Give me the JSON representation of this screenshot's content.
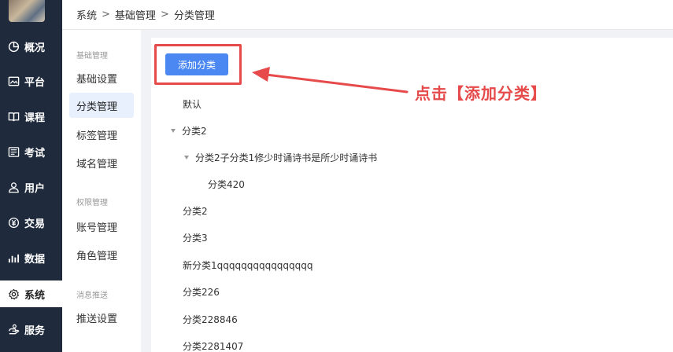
{
  "breadcrumb": {
    "items": [
      "系统",
      "基础管理",
      "分类管理"
    ],
    "separator": ">"
  },
  "sidebar": {
    "items": [
      {
        "label": "概况",
        "icon": "pie-chart-icon",
        "active": false
      },
      {
        "label": "平台",
        "icon": "image-icon",
        "active": false
      },
      {
        "label": "课程",
        "icon": "book-icon",
        "active": false
      },
      {
        "label": "考试",
        "icon": "exam-icon",
        "active": false
      },
      {
        "label": "用户",
        "icon": "user-icon",
        "active": false
      },
      {
        "label": "交易",
        "icon": "yen-icon",
        "active": false
      },
      {
        "label": "数据",
        "icon": "bar-chart-icon",
        "active": false
      },
      {
        "label": "系统",
        "icon": "gear-icon",
        "active": true
      },
      {
        "label": "服务",
        "icon": "service-icon",
        "active": false
      }
    ]
  },
  "submenu": {
    "groups": [
      {
        "title": "基础管理",
        "items": [
          "基础设置",
          "分类管理",
          "标签管理",
          "域名管理"
        ]
      },
      {
        "title": "权限管理",
        "items": [
          "账号管理",
          "角色管理"
        ]
      },
      {
        "title": "消息推送",
        "items": [
          "推送设置"
        ]
      }
    ],
    "active": "分类管理"
  },
  "main": {
    "add_button": "添加分类",
    "tree": [
      {
        "label": "默认",
        "level": 0,
        "expandable": false
      },
      {
        "label": "分类2",
        "level": 0,
        "expandable": true
      },
      {
        "label": "分类2子分类1修少时诵诗书是所少时诵诗书",
        "level": 1,
        "expandable": true
      },
      {
        "label": "分类420",
        "level": 2,
        "expandable": false
      },
      {
        "label": "分类2",
        "level": 0,
        "expandable": false
      },
      {
        "label": "分类3",
        "level": 0,
        "expandable": false
      },
      {
        "label": "新分类1qqqqqqqqqqqqqqqq",
        "level": 0,
        "expandable": false
      },
      {
        "label": "分类226",
        "level": 0,
        "expandable": false
      },
      {
        "label": "分类228846",
        "level": 0,
        "expandable": false
      },
      {
        "label": "分类2281407",
        "level": 0,
        "expandable": false
      }
    ]
  },
  "annotation": {
    "text": "点击【添加分类】",
    "color": "#e64a4a"
  },
  "colors": {
    "sidebar_bg": "#1f2a3c",
    "accent": "#4b88f2",
    "annotation": "#e64a4a"
  }
}
